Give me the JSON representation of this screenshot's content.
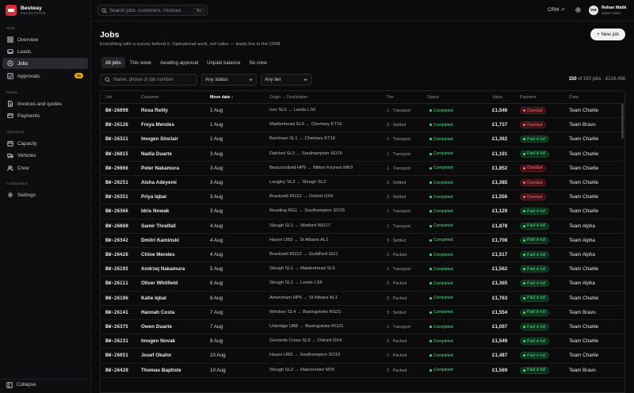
{
  "brand": {
    "name": "Bestway",
    "sub": "RELOCATION"
  },
  "sidebar": {
    "sections": [
      {
        "label": "Work",
        "items": [
          {
            "label": "Overview",
            "icon": "grid-icon"
          },
          {
            "label": "Leads",
            "icon": "inbox-icon"
          },
          {
            "label": "Jobs",
            "icon": "briefcase-icon",
            "active": true
          },
          {
            "label": "Approvals",
            "icon": "check-square-icon",
            "badge": "25"
          }
        ]
      },
      {
        "label": "Money",
        "items": [
          {
            "label": "Invoices and quotes",
            "icon": "file-icon"
          },
          {
            "label": "Payments",
            "icon": "card-icon"
          }
        ]
      },
      {
        "label": "Operations",
        "items": [
          {
            "label": "Capacity",
            "icon": "calendar-icon"
          },
          {
            "label": "Vehicles",
            "icon": "truck-icon"
          },
          {
            "label": "Crew",
            "icon": "users-icon"
          }
        ]
      },
      {
        "label": "Configuration",
        "items": [
          {
            "label": "Settings",
            "icon": "gear-icon"
          }
        ]
      }
    ],
    "collapse_label": "Collapse"
  },
  "topbar": {
    "search_placeholder": "Search jobs, customers, invoices",
    "search_shortcut": "⌘K",
    "crm_label": "CRM ↗",
    "user": {
      "initials": "RM",
      "name": "Rehan Malik",
      "role": "Super Admin"
    }
  },
  "page": {
    "title": "Jobs",
    "subtitle": "Everything with a survey behind it. Operational work, not sales — leads live in the CRM.",
    "new_button": "+ New job"
  },
  "tabs": [
    "All jobs",
    "This week",
    "Awaiting approval",
    "Unpaid balance",
    "No crew"
  ],
  "filters": {
    "search_placeholder": "Name, phone or job number",
    "status": "Any status",
    "tier": "Any tier"
  },
  "summary": {
    "shown": "150",
    "rest": " of 150 jobs · £216,458"
  },
  "table": {
    "headers": [
      "Job",
      "Customer",
      "Move date ↑",
      "Origin → Destination",
      "Tier",
      "Status",
      "Value",
      "Payment",
      "Crew"
    ],
    "rows": [
      {
        "job": "BW-26090",
        "customer": "Rosa Reilly",
        "date": "1 Aug",
        "route": "Iver SL0 → Leeds LS6",
        "tier": "1 · Transport",
        "status": "Completed",
        "value": "£1,546",
        "payment": "Overdue",
        "crew": "Team Charlie"
      },
      {
        "job": "BW-26126",
        "customer": "Freya Mendes",
        "date": "1 Aug",
        "route": "Maidenhead SL6 → Chertsey KT16",
        "tier": "3 · Settled",
        "status": "Completed",
        "value": "£1,737",
        "payment": "Overdue",
        "crew": "Team Bravo"
      },
      {
        "job": "BW-26321",
        "customer": "Imogen Sinclair",
        "date": "1 Aug",
        "route": "Burnham SL1 → Chertsey KT16",
        "tier": "1 · Transport",
        "status": "Completed",
        "value": "£1,362",
        "payment": "Paid in full",
        "crew": "Team Charlie"
      },
      {
        "job": "BW-26015",
        "customer": "Nadia Duarte",
        "date": "3 Aug",
        "route": "Datchet SL3 → Southampton SO15",
        "tier": "1 · Transport",
        "status": "Completed",
        "value": "£1,191",
        "payment": "Paid in full",
        "crew": "Team Charlie"
      },
      {
        "job": "BW-26066",
        "customer": "Peter Nakamura",
        "date": "3 Aug",
        "route": "Beaconsfield HP9 → Milton Keynes MK9",
        "tier": "1 · Transport",
        "status": "Completed",
        "value": "£1,852",
        "payment": "Overdue",
        "crew": "Team Charlie"
      },
      {
        "job": "BW-26251",
        "customer": "Aisha Adeyemi",
        "date": "3 Aug",
        "route": "Langley SL3 → Slough SL2",
        "tier": "3 · Settled",
        "status": "Completed",
        "value": "£1,385",
        "payment": "Overdue",
        "crew": "Team Charlie"
      },
      {
        "job": "BW-26351",
        "customer": "Priya Iqbal",
        "date": "3 Aug",
        "route": "Bracknell RG12 → Oxford OX4",
        "tier": "3 · Settled",
        "status": "Completed",
        "value": "£1,556",
        "payment": "Overdue",
        "crew": "Team Charlie"
      },
      {
        "job": "BW-26366",
        "customer": "Idris Nowak",
        "date": "3 Aug",
        "route": "Reading RG1 → Southampton SO15",
        "tier": "1 · Transport",
        "status": "Completed",
        "value": "£1,129",
        "payment": "Paid in full",
        "crew": "Team Charlie"
      },
      {
        "job": "BW-26060",
        "customer": "Samir Threlfall",
        "date": "4 Aug",
        "route": "Slough SL1 → Watford WD17",
        "tier": "1 · Transport",
        "status": "Completed",
        "value": "£1,878",
        "payment": "Paid in full",
        "crew": "Team Alpha"
      },
      {
        "job": "BW-26342",
        "customer": "Dmitri Kaminski",
        "date": "4 Aug",
        "route": "Hayes UB3 → St Albans AL1",
        "tier": "3 · Settled",
        "status": "Completed",
        "value": "£1,708",
        "payment": "Paid in full",
        "crew": "Team Alpha"
      },
      {
        "job": "BW-26426",
        "customer": "Chloe Mendes",
        "date": "4 Aug",
        "route": "Bracknell RG12 → Guildford GU1",
        "tier": "2 · Packed",
        "status": "Completed",
        "value": "£1,517",
        "payment": "Paid in full",
        "crew": "Team Alpha"
      },
      {
        "job": "BW-26195",
        "customer": "Andrzej Nakamura",
        "date": "5 Aug",
        "route": "Slough SL1 → Maidenhead SL6",
        "tier": "1 · Transport",
        "status": "Completed",
        "value": "£1,562",
        "payment": "Paid in full",
        "crew": "Team Charlie"
      },
      {
        "job": "BW-26111",
        "customer": "Oliver Whitfield",
        "date": "6 Aug",
        "route": "Slough SL1 → Leeds LS6",
        "tier": "2 · Packed",
        "status": "Completed",
        "value": "£1,365",
        "payment": "Paid in full",
        "crew": "Team Alpha"
      },
      {
        "job": "BW-26186",
        "customer": "Katie Iqbal",
        "date": "6 Aug",
        "route": "Amersham HP6 → St Albans AL1",
        "tier": "2 · Packed",
        "status": "Completed",
        "value": "£1,763",
        "payment": "Paid in full",
        "crew": "Team Charlie"
      },
      {
        "job": "BW-26141",
        "customer": "Hannah Costa",
        "date": "7 Aug",
        "route": "Windsor SL4 → Basingstoke RG21",
        "tier": "3 · Settled",
        "status": "Completed",
        "value": "£1,554",
        "payment": "Paid in full",
        "crew": "Team Bravo"
      },
      {
        "job": "BW-26375",
        "customer": "Owen Duarte",
        "date": "7 Aug",
        "route": "Uxbridge UB8 → Basingstoke RG21",
        "tier": "1 · Transport",
        "status": "Completed",
        "value": "£1,097",
        "payment": "Paid in full",
        "crew": "Team Charlie"
      },
      {
        "job": "BW-26231",
        "customer": "Imogen Novak",
        "date": "8 Aug",
        "route": "Gerrards Cross SL9 → Oxford OX4",
        "tier": "2 · Packed",
        "status": "Completed",
        "value": "£1,549",
        "payment": "Paid in full",
        "crew": "Team Charlie"
      },
      {
        "job": "BW-26051",
        "customer": "Josef Okafor",
        "date": "10 Aug",
        "route": "Hayes UB3 → Southampton SO15",
        "tier": "2 · Packed",
        "status": "Completed",
        "value": "£1,487",
        "payment": "Paid in full",
        "crew": "Team Charlie"
      },
      {
        "job": "BW-26420",
        "customer": "Thomas Baptiste",
        "date": "10 Aug",
        "route": "Slough SL2 → Manchester M20",
        "tier": "2 · Packed",
        "status": "Completed",
        "value": "£1,569",
        "payment": "Paid in full",
        "crew": "Team Bravo"
      }
    ]
  }
}
